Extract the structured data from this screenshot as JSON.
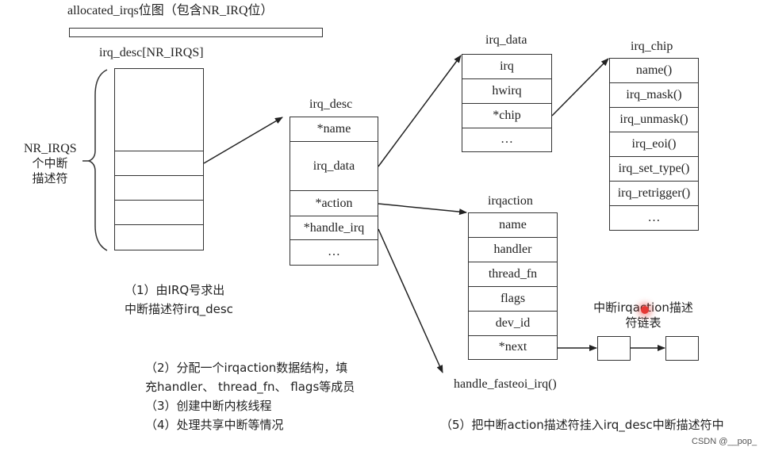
{
  "bitmap": {
    "label": "allocated_irqs位图（包含NR_IRQ位）"
  },
  "irq_desc_array": {
    "label": "irq_desc[NR_IRQS]",
    "brace_label": [
      "NR_IRQS",
      "个中断",
      "描述符"
    ]
  },
  "irq_desc": {
    "title": "irq_desc",
    "fields": [
      "*name",
      "irq_data",
      "*action",
      "*handle_irq",
      "…"
    ]
  },
  "irq_data": {
    "title": "irq_data",
    "fields": [
      "irq",
      "hwirq",
      "*chip",
      "…"
    ]
  },
  "irq_chip": {
    "title": "irq_chip",
    "fields": [
      "name()",
      "irq_mask()",
      "irq_unmask()",
      "irq_eoi()",
      "irq_set_type()",
      "irq_retrigger()",
      "…"
    ]
  },
  "irqaction": {
    "title": "irqaction",
    "fields": [
      "name",
      "handler",
      "thread_fn",
      "flags",
      "dev_id",
      "*next"
    ]
  },
  "handle_target": "handle_fasteoi_irq()",
  "chain_label": [
    "中断irqaction描述",
    "符链表"
  ],
  "steps": {
    "s1": [
      "（1）由IRQ号求出",
      "中断描述符irq_desc"
    ],
    "s2": [
      "（2）分配一个irqaction数据结构，填",
      "充handler、 thread_fn、 flags等成员"
    ],
    "s3": "（3）创建中断内核线程",
    "s4": "（4）处理共享中断等情况",
    "s5": "（5）把中断action描述符挂入irq_desc中断描述符中"
  },
  "watermark": "CSDN @__pop_",
  "colors": {
    "line": "#333333",
    "cursor_dot": "#e53935"
  }
}
